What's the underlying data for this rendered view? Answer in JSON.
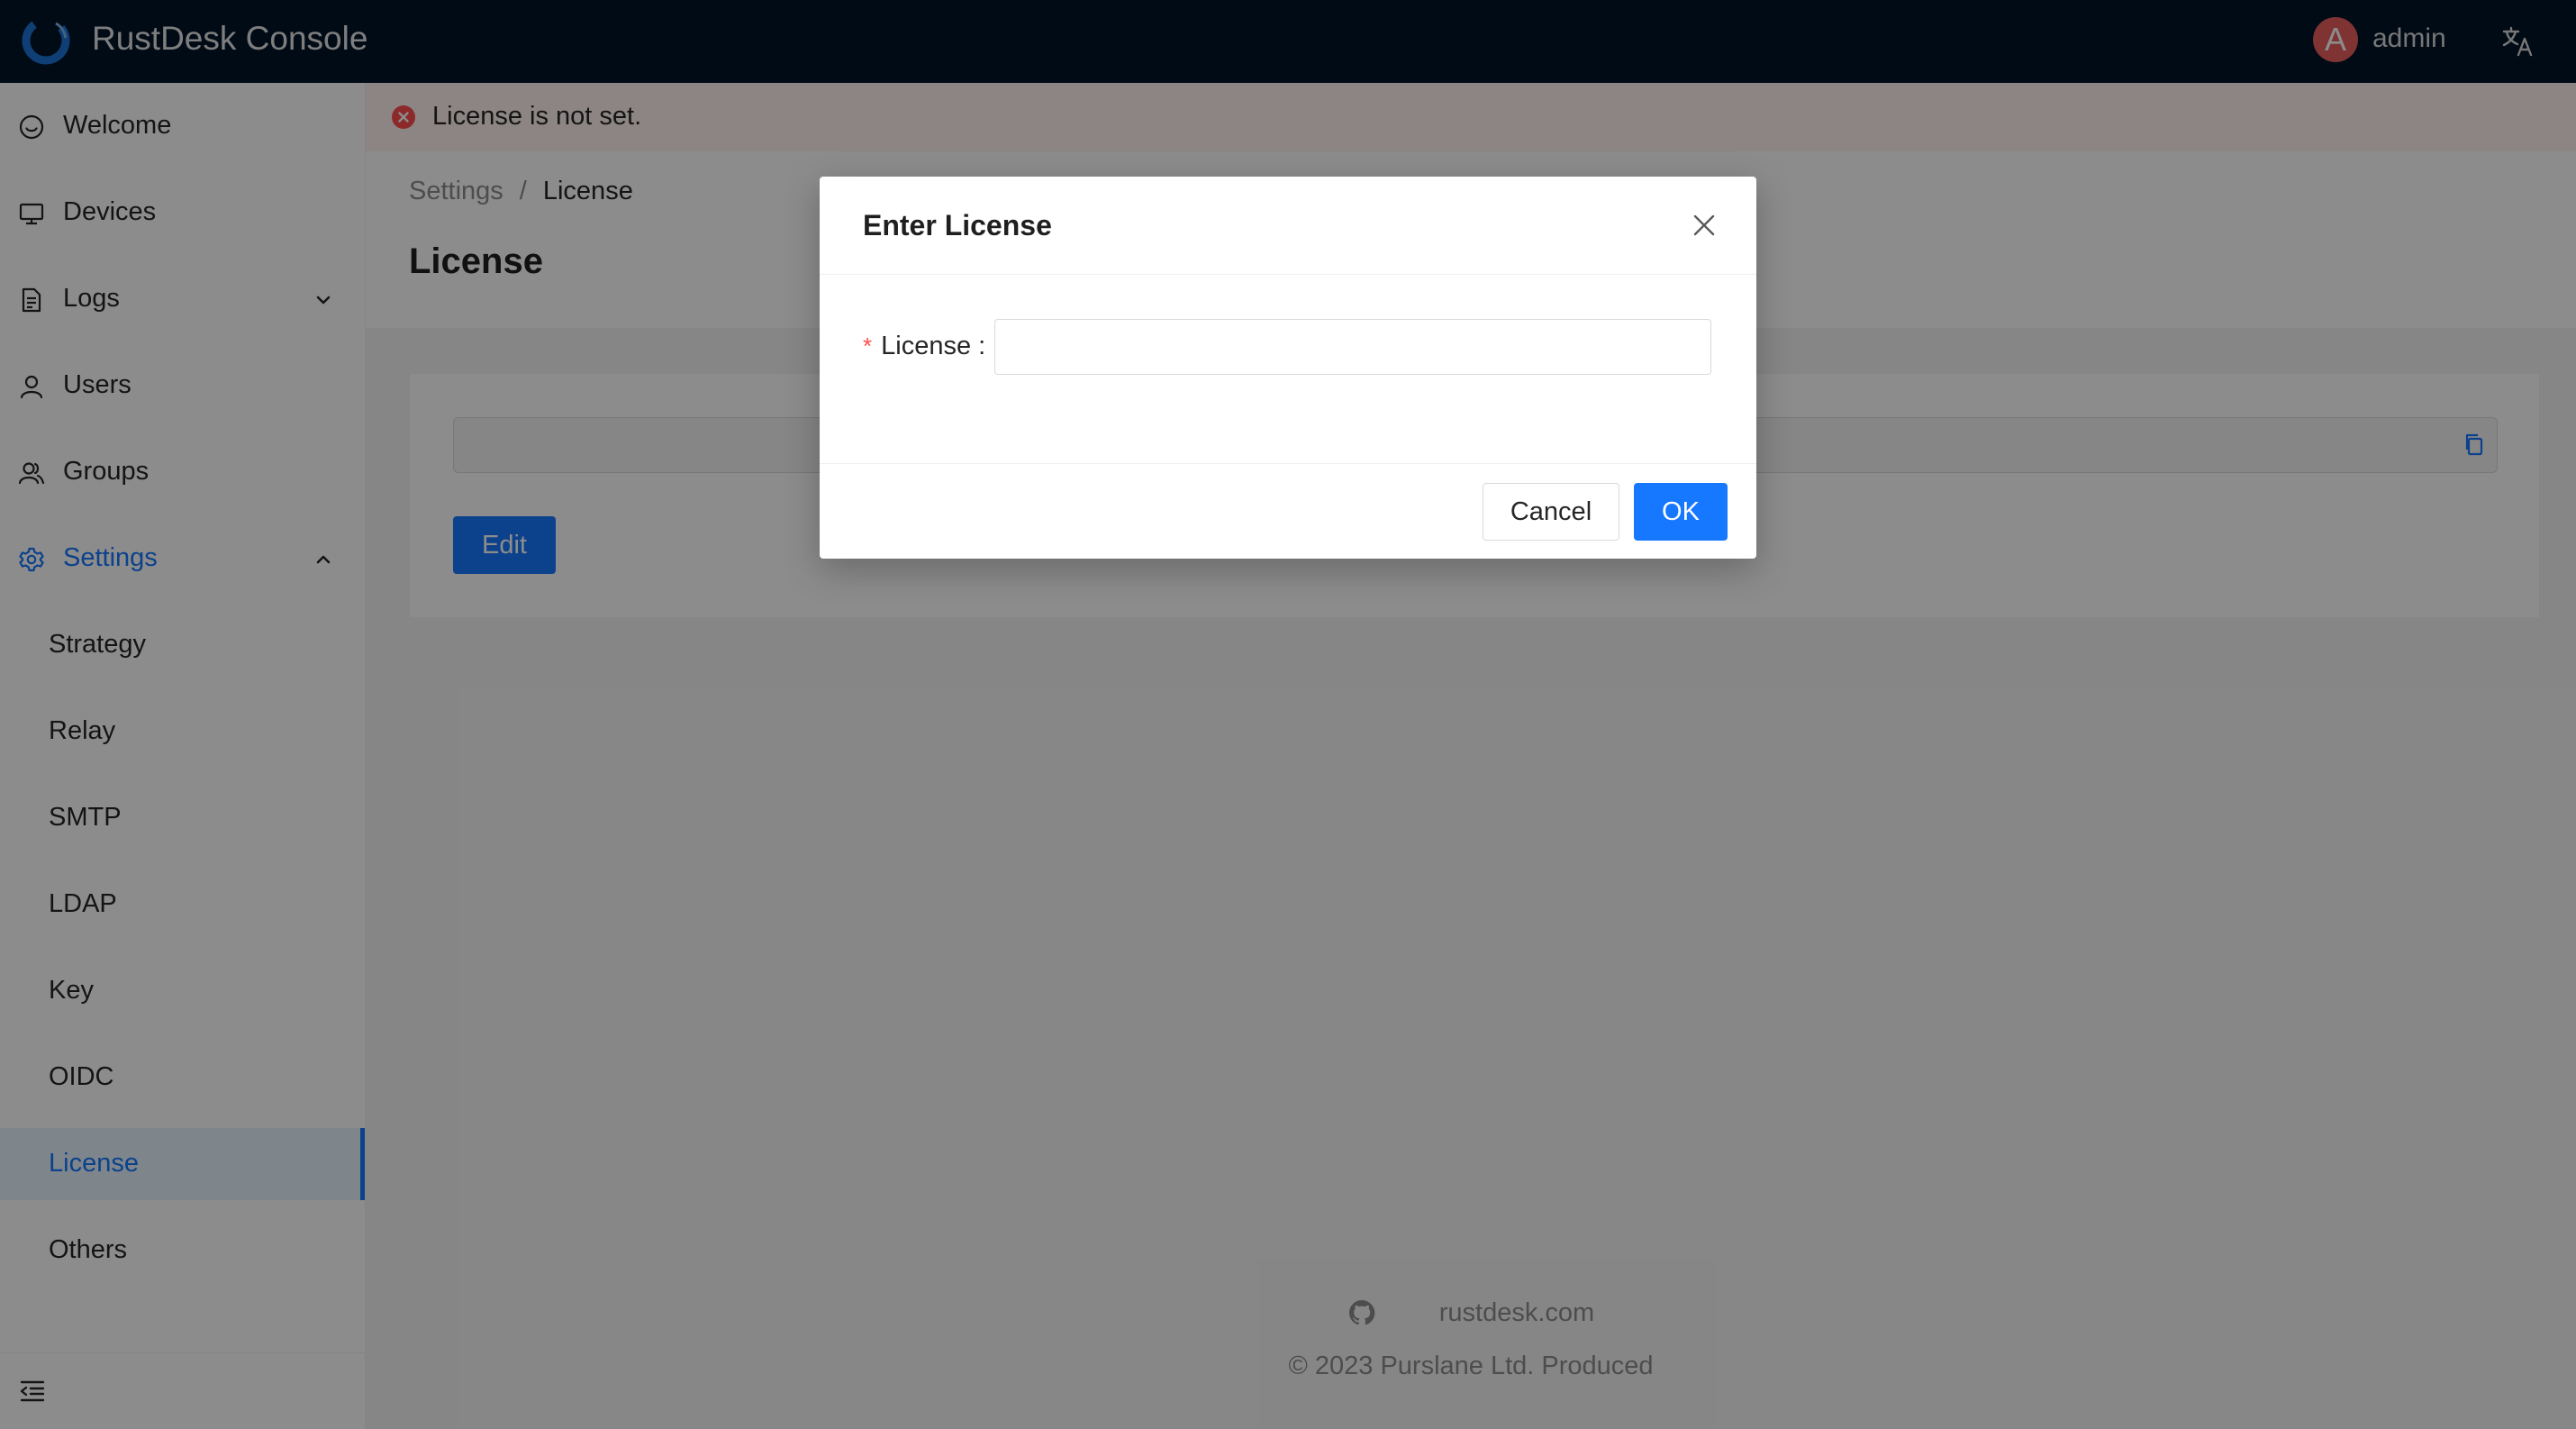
{
  "header": {
    "app_title": "RustDesk Console",
    "avatar_letter": "A",
    "username": "admin",
    "logo_icon": "rustdesk-logo-icon",
    "language_icon": "translate-icon"
  },
  "sidebar": {
    "items": [
      {
        "label": "Welcome",
        "icon": "smile-icon"
      },
      {
        "label": "Devices",
        "icon": "desktop-icon"
      },
      {
        "label": "Logs",
        "icon": "file-icon",
        "expandable": true,
        "expanded": false
      },
      {
        "label": "Users",
        "icon": "user-icon"
      },
      {
        "label": "Groups",
        "icon": "team-icon"
      },
      {
        "label": "Settings",
        "icon": "gear-icon",
        "expandable": true,
        "expanded": true
      }
    ],
    "settings_children": [
      {
        "label": "Strategy"
      },
      {
        "label": "Relay"
      },
      {
        "label": "SMTP"
      },
      {
        "label": "LDAP"
      },
      {
        "label": "Key"
      },
      {
        "label": "OIDC"
      },
      {
        "label": "License",
        "selected": true
      },
      {
        "label": "Others"
      }
    ],
    "collapse_icon": "menu-fold-icon"
  },
  "alert": {
    "type": "error",
    "text": "License is not set."
  },
  "breadcrumb": {
    "parent": "Settings",
    "separator": "/",
    "current": "License"
  },
  "page": {
    "title": "License",
    "license_value": "",
    "edit_label": "Edit"
  },
  "footer": {
    "site": "rustdesk.com",
    "copyright": "2023 Purslane Ltd. Produced"
  },
  "modal": {
    "title": "Enter License",
    "field_label": "License",
    "field_value": "",
    "cancel_label": "Cancel",
    "ok_label": "OK"
  },
  "colors": {
    "header_bg": "#001529",
    "primary": "#1677ff",
    "error": "#ff4d4f",
    "alert_bg": "#fff2f0"
  }
}
